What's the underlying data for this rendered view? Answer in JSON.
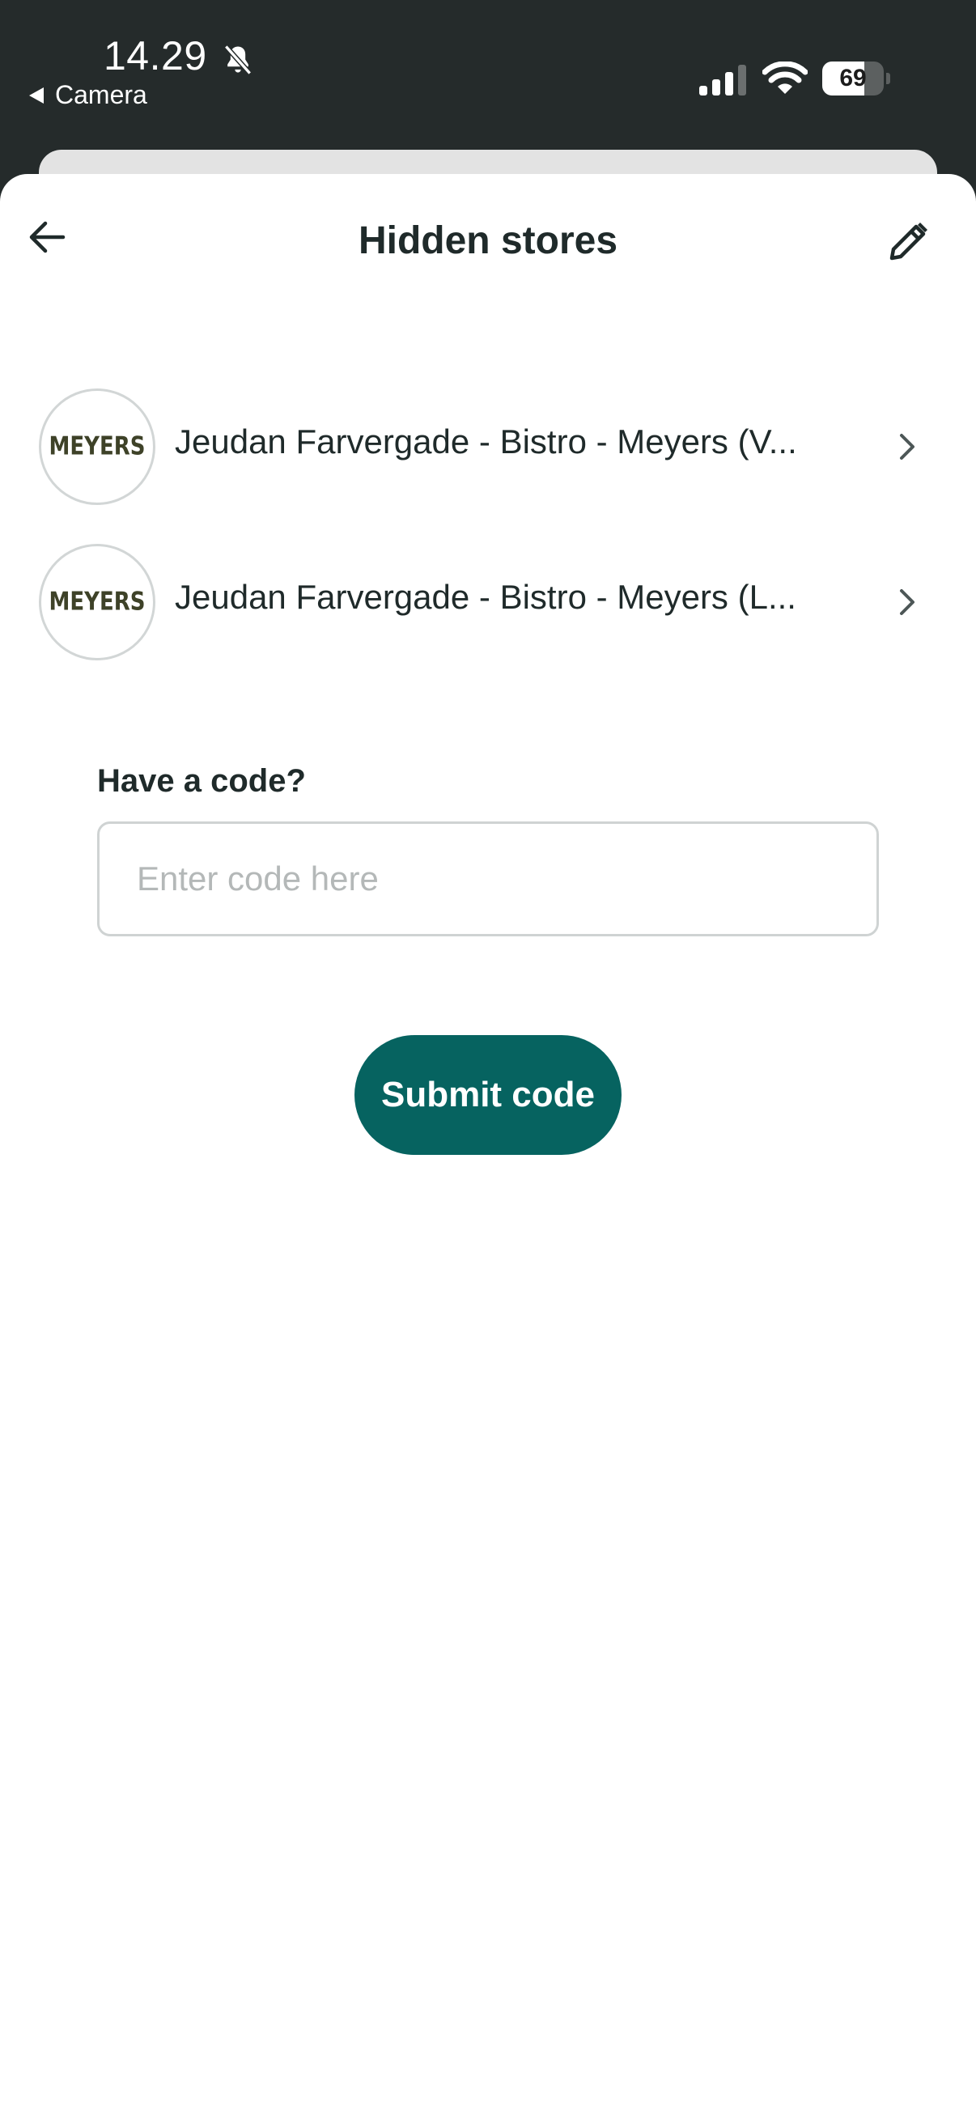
{
  "status_bar": {
    "time": "14.29",
    "back_app_label": "Camera",
    "battery_percent": "69",
    "battery_level": 0.69,
    "icons": [
      "bell-slash-icon",
      "cellular-signal-icon",
      "wifi-icon",
      "battery-icon"
    ]
  },
  "header": {
    "title": "Hidden stores",
    "back_icon": "arrow-left-icon",
    "edit_icon": "pencil-icon"
  },
  "stores": [
    {
      "logo_text": "MEYERS",
      "name": "Jeudan Farvergade - Bistro - Meyers (V..."
    },
    {
      "logo_text": "MEYERS",
      "name": "Jeudan Farvergade - Bistro - Meyers (L..."
    }
  ],
  "code_form": {
    "label": "Have a code?",
    "placeholder": "Enter code here",
    "value": "",
    "submit_label": "Submit code"
  },
  "colors": {
    "status_bar_bg": "#252b2b",
    "accent": "#066360",
    "text_primary": "#1f2a2a",
    "logo_text": "#3e4228"
  }
}
